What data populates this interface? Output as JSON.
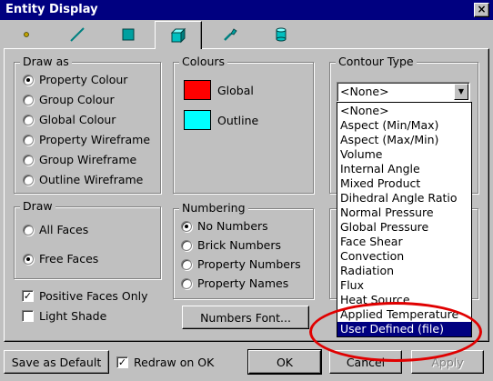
{
  "window": {
    "title": "Entity Display",
    "close_label": "×"
  },
  "tabs": [
    {
      "icon": "node-dot-icon",
      "active": false
    },
    {
      "icon": "beam-line-icon",
      "active": false
    },
    {
      "icon": "plate-square-icon",
      "active": false
    },
    {
      "icon": "brick-cube-icon",
      "active": true
    },
    {
      "icon": "link-tool-icon",
      "active": false
    },
    {
      "icon": "cylinder-icon",
      "active": false
    }
  ],
  "draw_as": {
    "title": "Draw as",
    "options": [
      {
        "label": "Property Colour",
        "selected": true
      },
      {
        "label": "Group Colour",
        "selected": false
      },
      {
        "label": "Global Colour",
        "selected": false
      },
      {
        "label": "Property Wireframe",
        "selected": false
      },
      {
        "label": "Group Wireframe",
        "selected": false
      },
      {
        "label": "Outline Wireframe",
        "selected": false
      }
    ]
  },
  "colours": {
    "title": "Colours",
    "items": [
      {
        "label": "Global",
        "color": "#ff0000"
      },
      {
        "label": "Outline",
        "color": "#00ffff"
      }
    ]
  },
  "contour": {
    "title": "Contour Type",
    "selected": "<None>",
    "options": [
      "<None>",
      "Aspect (Min/Max)",
      "Aspect (Max/Min)",
      "Volume",
      "Internal Angle",
      "Mixed Product",
      "Dihedral Angle Ratio",
      "Normal Pressure",
      "Global Pressure",
      "Face Shear",
      "Convection",
      "Radiation",
      "Flux",
      "Heat Source",
      "Applied Temperature",
      "User Defined (file)"
    ],
    "highlighted": "User Defined (file)",
    "annotation_color": "#e00000"
  },
  "draw": {
    "title": "Draw",
    "options": [
      {
        "label": "All Faces",
        "selected": false
      },
      {
        "label": "Free Faces",
        "selected": true
      }
    ]
  },
  "numbering": {
    "title": "Numbering",
    "options": [
      {
        "label": "No Numbers",
        "selected": true
      },
      {
        "label": "Brick Numbers",
        "selected": false
      },
      {
        "label": "Property Numbers",
        "selected": false
      },
      {
        "label": "Property Names",
        "selected": false
      }
    ],
    "font_button": "Numbers Font..."
  },
  "checks": {
    "positive_faces": {
      "label": "Positive Faces Only",
      "checked": true
    },
    "light_shade": {
      "label": "Light Shade",
      "checked": false
    },
    "redraw": {
      "label": "Redraw on OK",
      "checked": true
    }
  },
  "buttons": {
    "save_default": "Save as Default",
    "ok": "OK",
    "cancel": "Cancel",
    "apply": "Apply"
  }
}
